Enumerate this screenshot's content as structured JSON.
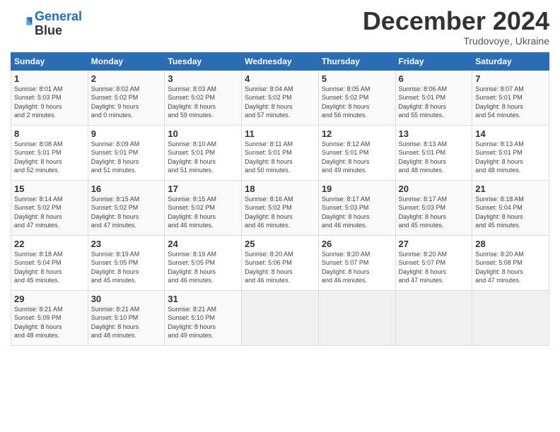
{
  "logo": {
    "line1": "General",
    "line2": "Blue"
  },
  "title": "December 2024",
  "subtitle": "Trudovoye, Ukraine",
  "days_of_week": [
    "Sunday",
    "Monday",
    "Tuesday",
    "Wednesday",
    "Thursday",
    "Friday",
    "Saturday"
  ],
  "weeks": [
    [
      {
        "day": "1",
        "info": "Sunrise: 8:01 AM\nSunset: 5:03 PM\nDaylight: 9 hours\nand 2 minutes."
      },
      {
        "day": "2",
        "info": "Sunrise: 8:02 AM\nSunset: 5:02 PM\nDaylight: 9 hours\nand 0 minutes."
      },
      {
        "day": "3",
        "info": "Sunrise: 8:03 AM\nSunset: 5:02 PM\nDaylight: 8 hours\nand 59 minutes."
      },
      {
        "day": "4",
        "info": "Sunrise: 8:04 AM\nSunset: 5:02 PM\nDaylight: 8 hours\nand 57 minutes."
      },
      {
        "day": "5",
        "info": "Sunrise: 8:05 AM\nSunset: 5:02 PM\nDaylight: 8 hours\nand 56 minutes."
      },
      {
        "day": "6",
        "info": "Sunrise: 8:06 AM\nSunset: 5:01 PM\nDaylight: 8 hours\nand 55 minutes."
      },
      {
        "day": "7",
        "info": "Sunrise: 8:07 AM\nSunset: 5:01 PM\nDaylight: 8 hours\nand 54 minutes."
      }
    ],
    [
      {
        "day": "8",
        "info": "Sunrise: 8:08 AM\nSunset: 5:01 PM\nDaylight: 8 hours\nand 52 minutes."
      },
      {
        "day": "9",
        "info": "Sunrise: 8:09 AM\nSunset: 5:01 PM\nDaylight: 8 hours\nand 51 minutes."
      },
      {
        "day": "10",
        "info": "Sunrise: 8:10 AM\nSunset: 5:01 PM\nDaylight: 8 hours\nand 51 minutes."
      },
      {
        "day": "11",
        "info": "Sunrise: 8:11 AM\nSunset: 5:01 PM\nDaylight: 8 hours\nand 50 minutes."
      },
      {
        "day": "12",
        "info": "Sunrise: 8:12 AM\nSunset: 5:01 PM\nDaylight: 8 hours\nand 49 minutes."
      },
      {
        "day": "13",
        "info": "Sunrise: 8:13 AM\nSunset: 5:01 PM\nDaylight: 8 hours\nand 48 minutes."
      },
      {
        "day": "14",
        "info": "Sunrise: 8:13 AM\nSunset: 5:01 PM\nDaylight: 8 hours\nand 48 minutes."
      }
    ],
    [
      {
        "day": "15",
        "info": "Sunrise: 8:14 AM\nSunset: 5:02 PM\nDaylight: 8 hours\nand 47 minutes."
      },
      {
        "day": "16",
        "info": "Sunrise: 8:15 AM\nSunset: 5:02 PM\nDaylight: 8 hours\nand 47 minutes."
      },
      {
        "day": "17",
        "info": "Sunrise: 8:15 AM\nSunset: 5:02 PM\nDaylight: 8 hours\nand 46 minutes."
      },
      {
        "day": "18",
        "info": "Sunrise: 8:16 AM\nSunset: 5:02 PM\nDaylight: 8 hours\nand 46 minutes."
      },
      {
        "day": "19",
        "info": "Sunrise: 8:17 AM\nSunset: 5:03 PM\nDaylight: 8 hours\nand 46 minutes."
      },
      {
        "day": "20",
        "info": "Sunrise: 8:17 AM\nSunset: 5:03 PM\nDaylight: 8 hours\nand 45 minutes."
      },
      {
        "day": "21",
        "info": "Sunrise: 8:18 AM\nSunset: 5:04 PM\nDaylight: 8 hours\nand 45 minutes."
      }
    ],
    [
      {
        "day": "22",
        "info": "Sunrise: 8:18 AM\nSunset: 5:04 PM\nDaylight: 8 hours\nand 45 minutes."
      },
      {
        "day": "23",
        "info": "Sunrise: 8:19 AM\nSunset: 5:05 PM\nDaylight: 8 hours\nand 45 minutes."
      },
      {
        "day": "24",
        "info": "Sunrise: 8:19 AM\nSunset: 5:05 PM\nDaylight: 8 hours\nand 46 minutes."
      },
      {
        "day": "25",
        "info": "Sunrise: 8:20 AM\nSunset: 5:06 PM\nDaylight: 8 hours\nand 46 minutes."
      },
      {
        "day": "26",
        "info": "Sunrise: 8:20 AM\nSunset: 5:07 PM\nDaylight: 8 hours\nand 46 minutes."
      },
      {
        "day": "27",
        "info": "Sunrise: 8:20 AM\nSunset: 5:07 PM\nDaylight: 8 hours\nand 47 minutes."
      },
      {
        "day": "28",
        "info": "Sunrise: 8:20 AM\nSunset: 5:08 PM\nDaylight: 8 hours\nand 47 minutes."
      }
    ],
    [
      {
        "day": "29",
        "info": "Sunrise: 8:21 AM\nSunset: 5:09 PM\nDaylight: 8 hours\nand 48 minutes."
      },
      {
        "day": "30",
        "info": "Sunrise: 8:21 AM\nSunset: 5:10 PM\nDaylight: 8 hours\nand 48 minutes."
      },
      {
        "day": "31",
        "info": "Sunrise: 8:21 AM\nSunset: 5:10 PM\nDaylight: 8 hours\nand 49 minutes."
      },
      {
        "day": "",
        "info": ""
      },
      {
        "day": "",
        "info": ""
      },
      {
        "day": "",
        "info": ""
      },
      {
        "day": "",
        "info": ""
      }
    ]
  ]
}
